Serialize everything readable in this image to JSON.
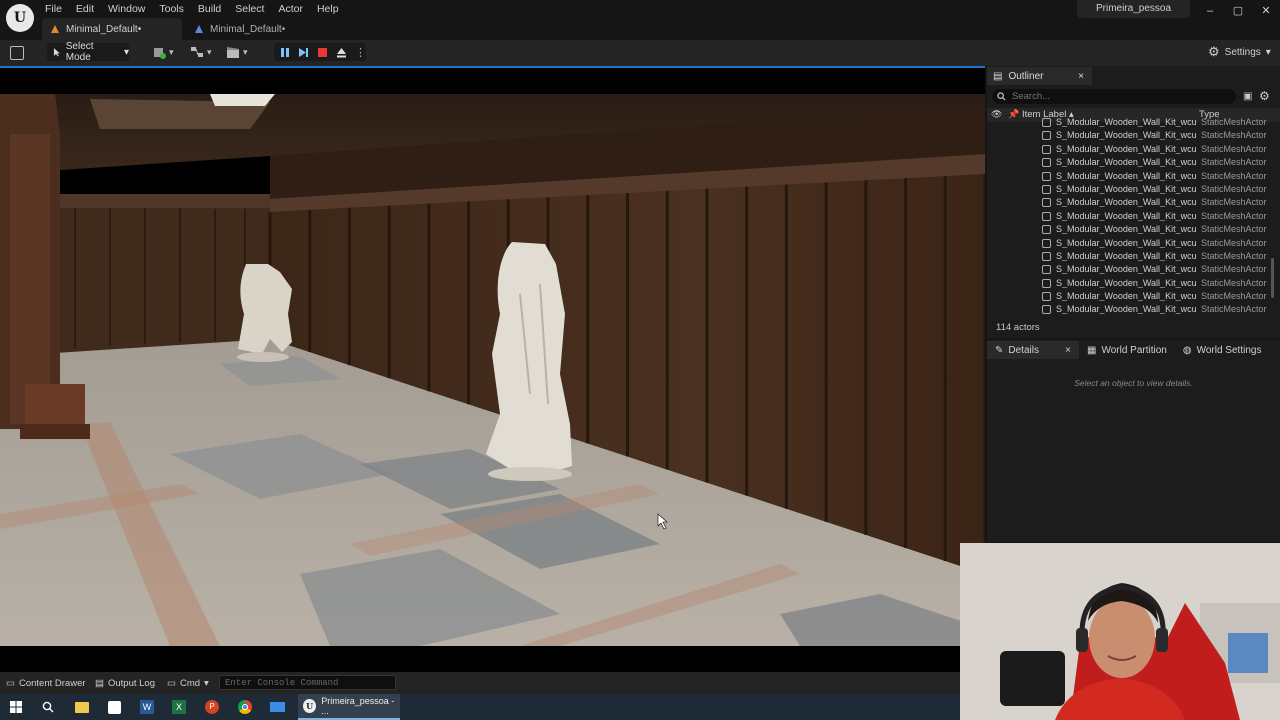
{
  "menu": [
    "File",
    "Edit",
    "Window",
    "Tools",
    "Build",
    "Select",
    "Actor",
    "Help"
  ],
  "tabs": [
    {
      "label": "Minimal_Default•"
    },
    {
      "label": "Minimal_Default•"
    }
  ],
  "project_name": "Primeira_pessoa",
  "window_controls": {
    "minimize": "–",
    "maximize": "▢",
    "close": "✕"
  },
  "toolbar": {
    "select_mode": "Select Mode",
    "settings": "Settings"
  },
  "outliner": {
    "tab_label": "Outliner",
    "search_placeholder": "Search...",
    "col_label": "Item Label ▴",
    "col_type": "Type",
    "rows": [
      {
        "label": "S_Modular_Wooden_Wall_Kit_wcusdi",
        "type": "StaticMeshActor"
      },
      {
        "label": "S_Modular_Wooden_Wall_Kit_wcusdi",
        "type": "StaticMeshActor"
      },
      {
        "label": "S_Modular_Wooden_Wall_Kit_wcusdi",
        "type": "StaticMeshActor"
      },
      {
        "label": "S_Modular_Wooden_Wall_Kit_wcusdi",
        "type": "StaticMeshActor"
      },
      {
        "label": "S_Modular_Wooden_Wall_Kit_wcusdi",
        "type": "StaticMeshActor"
      },
      {
        "label": "S_Modular_Wooden_Wall_Kit_wcusdi",
        "type": "StaticMeshActor"
      },
      {
        "label": "S_Modular_Wooden_Wall_Kit_wcusdi",
        "type": "StaticMeshActor"
      },
      {
        "label": "S_Modular_Wooden_Wall_Kit_wcusdi",
        "type": "StaticMeshActor"
      },
      {
        "label": "S_Modular_Wooden_Wall_Kit_wcusdi",
        "type": "StaticMeshActor"
      },
      {
        "label": "S_Modular_Wooden_Wall_Kit_wcusdi",
        "type": "StaticMeshActor"
      },
      {
        "label": "S_Modular_Wooden_Wall_Kit_wcusdi",
        "type": "StaticMeshActor"
      },
      {
        "label": "S_Modular_Wooden_Wall_Kit_wcusdi",
        "type": "StaticMeshActor"
      },
      {
        "label": "S_Modular_Wooden_Wall_Kit_wcusdi",
        "type": "StaticMeshActor"
      },
      {
        "label": "S_Modular_Wooden_Wall_Kit_wcusdi",
        "type": "StaticMeshActor"
      },
      {
        "label": "S_Modular_Wooden_Wall_Kit_wcusdi",
        "type": "StaticMeshActor"
      }
    ],
    "actor_count": "114 actors"
  },
  "details": {
    "tab_details": "Details",
    "tab_world_partition": "World Partition",
    "tab_world_settings": "World Settings",
    "empty_message": "Select an object to view details."
  },
  "bottom": {
    "content_drawer": "Content Drawer",
    "output_log": "Output Log",
    "cmd": "Cmd",
    "console_placeholder": "Enter Console Command"
  },
  "taskbar": {
    "active_app": "Primeira_pessoa - ..."
  }
}
